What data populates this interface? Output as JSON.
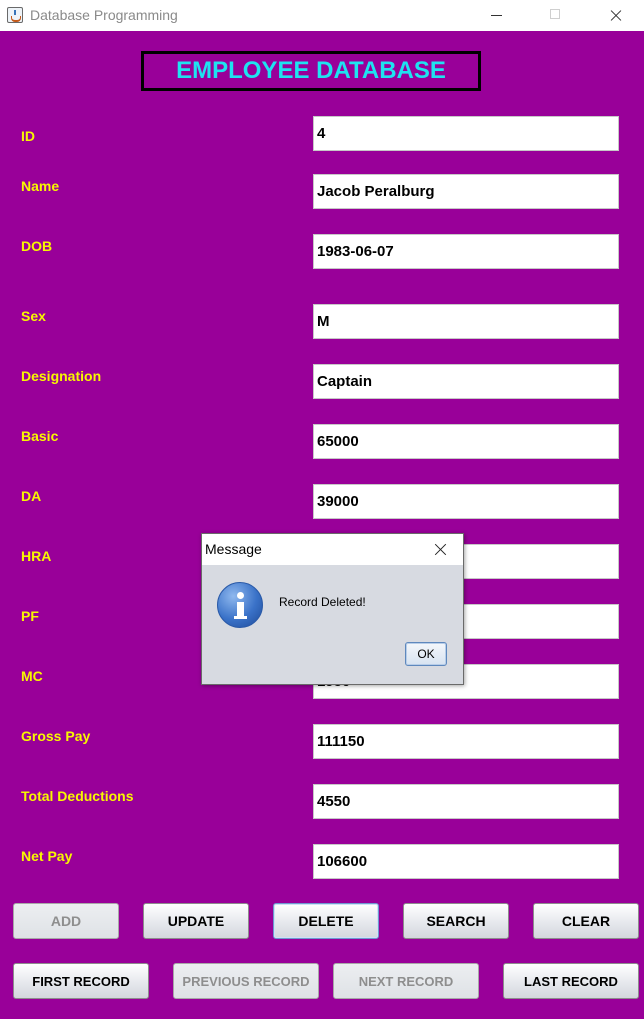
{
  "window": {
    "title": "Database Programming",
    "icon": "java-cup-icon"
  },
  "banner": {
    "title": "EMPLOYEE DATABASE"
  },
  "fields": [
    {
      "label": "ID",
      "value": "4"
    },
    {
      "label": "Name",
      "value": "Jacob Peralburg"
    },
    {
      "label": "DOB",
      "value": "1983-06-07"
    },
    {
      "label": "Sex",
      "value": "M"
    },
    {
      "label": "Designation",
      "value": "Captain"
    },
    {
      "label": "Basic",
      "value": "65000"
    },
    {
      "label": "DA",
      "value": "39000"
    },
    {
      "label": "HRA",
      "value": ""
    },
    {
      "label": "PF",
      "value": ""
    },
    {
      "label": "MC",
      "value": "1950"
    },
    {
      "label": "Gross Pay",
      "value": "111150"
    },
    {
      "label": "Total Deductions",
      "value": "4550"
    },
    {
      "label": "Net Pay",
      "value": "106600"
    }
  ],
  "buttons": {
    "add": "ADD",
    "update": "UPDATE",
    "delete": "DELETE",
    "search": "SEARCH",
    "clear": "CLEAR",
    "first": "FIRST RECORD",
    "previous": "PREVIOUS RECORD",
    "next": "NEXT RECORD",
    "last": "LAST RECORD"
  },
  "dialog": {
    "title": "Message",
    "message": "Record Deleted!",
    "ok": "OK",
    "icon": "information-icon"
  },
  "colors": {
    "background": "#990099",
    "label": "#f7f700",
    "banner_text": "#1ee3f0"
  }
}
